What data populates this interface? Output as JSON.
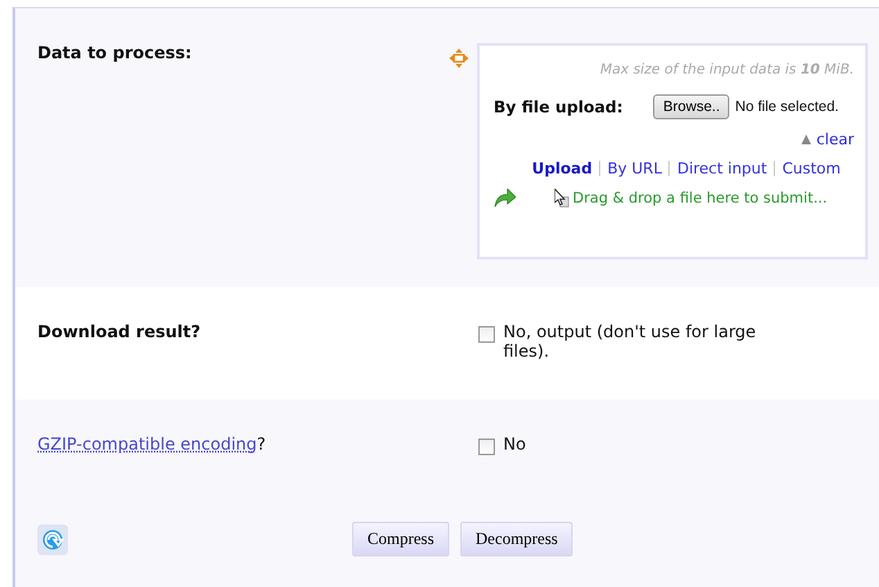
{
  "data_row": {
    "label": "Data to process:",
    "max_size_note": "Max size of the input data is **10** MiB.",
    "upload_label": "By file upload:",
    "browse_button": "Browse..",
    "file_status": "No file selected.",
    "clear_link": "clear",
    "tabs": [
      {
        "label": "Upload",
        "selected": true
      },
      {
        "label": "By URL",
        "selected": false
      },
      {
        "label": "Direct input",
        "selected": false
      },
      {
        "label": "Custom",
        "selected": false
      }
    ],
    "drop_hint": "Drag & drop a file here to submit..."
  },
  "download_row": {
    "label": "Download result?",
    "checked": false,
    "option": "No, output (don't use for large files)."
  },
  "gzip_row": {
    "link": "GZIP-compatible encoding",
    "suffix": "?",
    "checked": false,
    "option": "No"
  },
  "buttons": [
    "Compress",
    "Decompress"
  ]
}
